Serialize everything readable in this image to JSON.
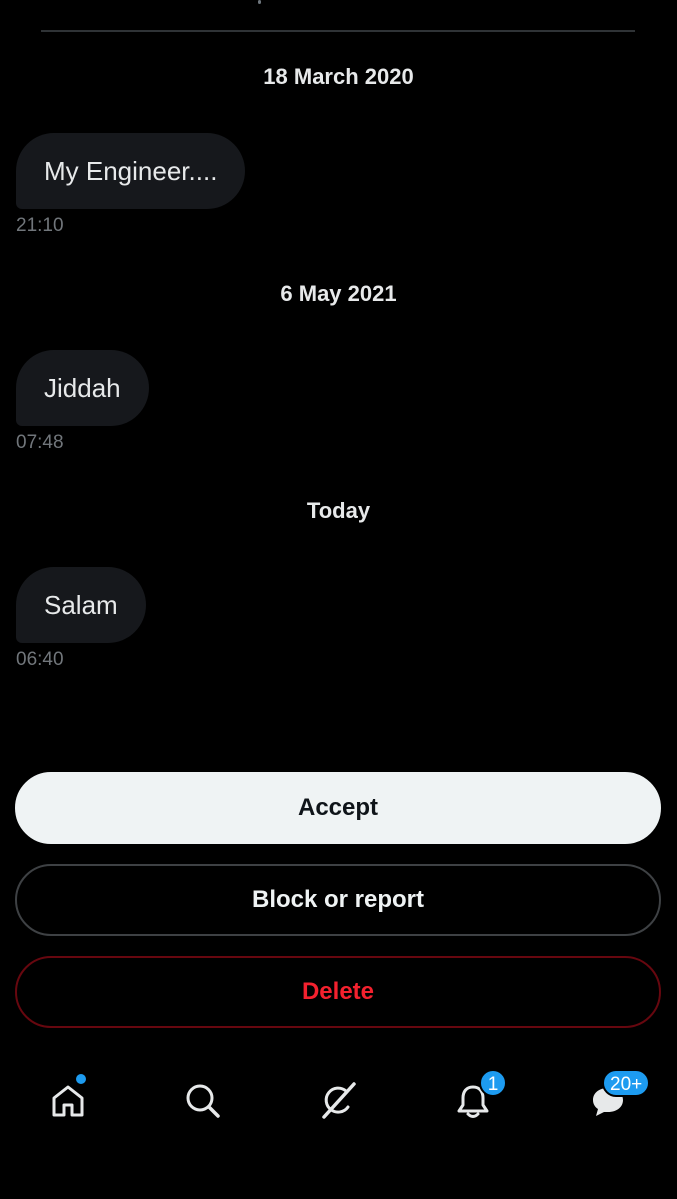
{
  "conversation": [
    {
      "date": "18 March 2020",
      "message": "My Engineer....",
      "time": "21:10"
    },
    {
      "date": "6 May 2021",
      "message": "Jiddah",
      "time": "07:48"
    },
    {
      "date": "Today",
      "message": "Salam",
      "time": "06:40"
    }
  ],
  "actions": {
    "accept_label": "Accept",
    "block_label": "Block or report",
    "delete_label": "Delete"
  },
  "bottom_nav": {
    "items": [
      {
        "icon": "home-icon",
        "indicator": "dot"
      },
      {
        "icon": "search-icon"
      },
      {
        "icon": "grok-icon"
      },
      {
        "icon": "bell-icon",
        "badge": "1"
      },
      {
        "icon": "messages-icon",
        "badge": "20+"
      }
    ]
  },
  "colors": {
    "background": "#000000",
    "bubble": "#16181c",
    "accent": "#1d9bf0",
    "danger": "#f4212e",
    "muted_text": "#71767b"
  }
}
